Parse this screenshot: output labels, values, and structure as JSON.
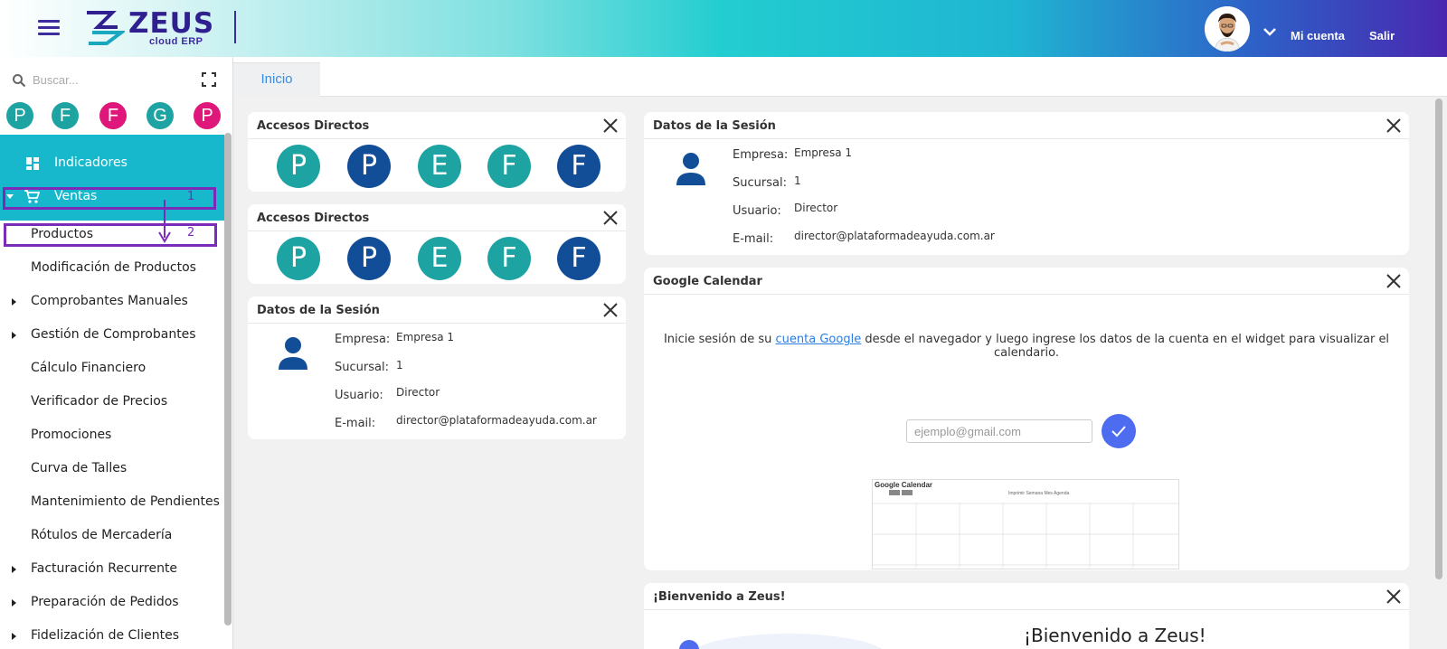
{
  "header": {
    "logo_text": "ZEUS",
    "logo_sub": "cloud ERP",
    "account_label": "Mi cuenta",
    "logout_label": "Salir"
  },
  "sidebar": {
    "search_placeholder": "Buscar...",
    "favorites": [
      {
        "letter": "P",
        "color": "#1ea3a3"
      },
      {
        "letter": "F",
        "color": "#1ea3a3"
      },
      {
        "letter": "F",
        "color": "#e0177a"
      },
      {
        "letter": "G",
        "color": "#1ea3a3"
      },
      {
        "letter": "P",
        "color": "#e0177a"
      }
    ],
    "items": [
      {
        "label": "Indicadores"
      },
      {
        "label": "Ventas"
      },
      {
        "label": "Productos"
      },
      {
        "label": "Modificación de Productos"
      },
      {
        "label": "Comprobantes Manuales"
      },
      {
        "label": "Gestión de Comprobantes"
      },
      {
        "label": "Cálculo Financiero"
      },
      {
        "label": "Verificador de Precios"
      },
      {
        "label": "Promociones"
      },
      {
        "label": "Curva de Talles"
      },
      {
        "label": "Mantenimiento de Pendientes"
      },
      {
        "label": "Rótulos de Mercadería"
      },
      {
        "label": "Facturación Recurrente"
      },
      {
        "label": "Preparación de Pedidos"
      },
      {
        "label": "Fidelización de Clientes"
      }
    ],
    "annotations": [
      "1",
      "2"
    ]
  },
  "tabs": [
    {
      "label": "Inicio"
    }
  ],
  "widgets": {
    "shortcuts_title": "Accesos Directos",
    "shortcuts": [
      {
        "letter": "P",
        "color": "#1ea3a3"
      },
      {
        "letter": "P",
        "color": "#124e97"
      },
      {
        "letter": "E",
        "color": "#1ea3a3"
      },
      {
        "letter": "F",
        "color": "#1ea3a3"
      },
      {
        "letter": "F",
        "color": "#124e97"
      }
    ],
    "session": {
      "title": "Datos de la Sesión",
      "empresa_label": "Empresa:",
      "empresa": "Empresa 1",
      "sucursal_label": "Sucursal:",
      "sucursal": "1",
      "usuario_label": "Usuario:",
      "usuario": "Director",
      "email_label": "E-mail:",
      "email": "director@plataformadeayuda.com.ar"
    },
    "calendar": {
      "title": "Google Calendar",
      "text_before": "Inicie sesión de su ",
      "link": "cuenta Google",
      "text_after": " desde el navegador y luego ingrese los datos de la cuenta en el widget para visualizar el calendario.",
      "placeholder": "ejemplo@gmail.com",
      "preview_title": "Google Calendar",
      "preview_nav": "Imprimir   Semana   Mes   Agenda"
    },
    "welcome": {
      "title": "¡Bienvenido a Zeus!",
      "heading": "¡Bienvenido a Zeus!"
    }
  }
}
